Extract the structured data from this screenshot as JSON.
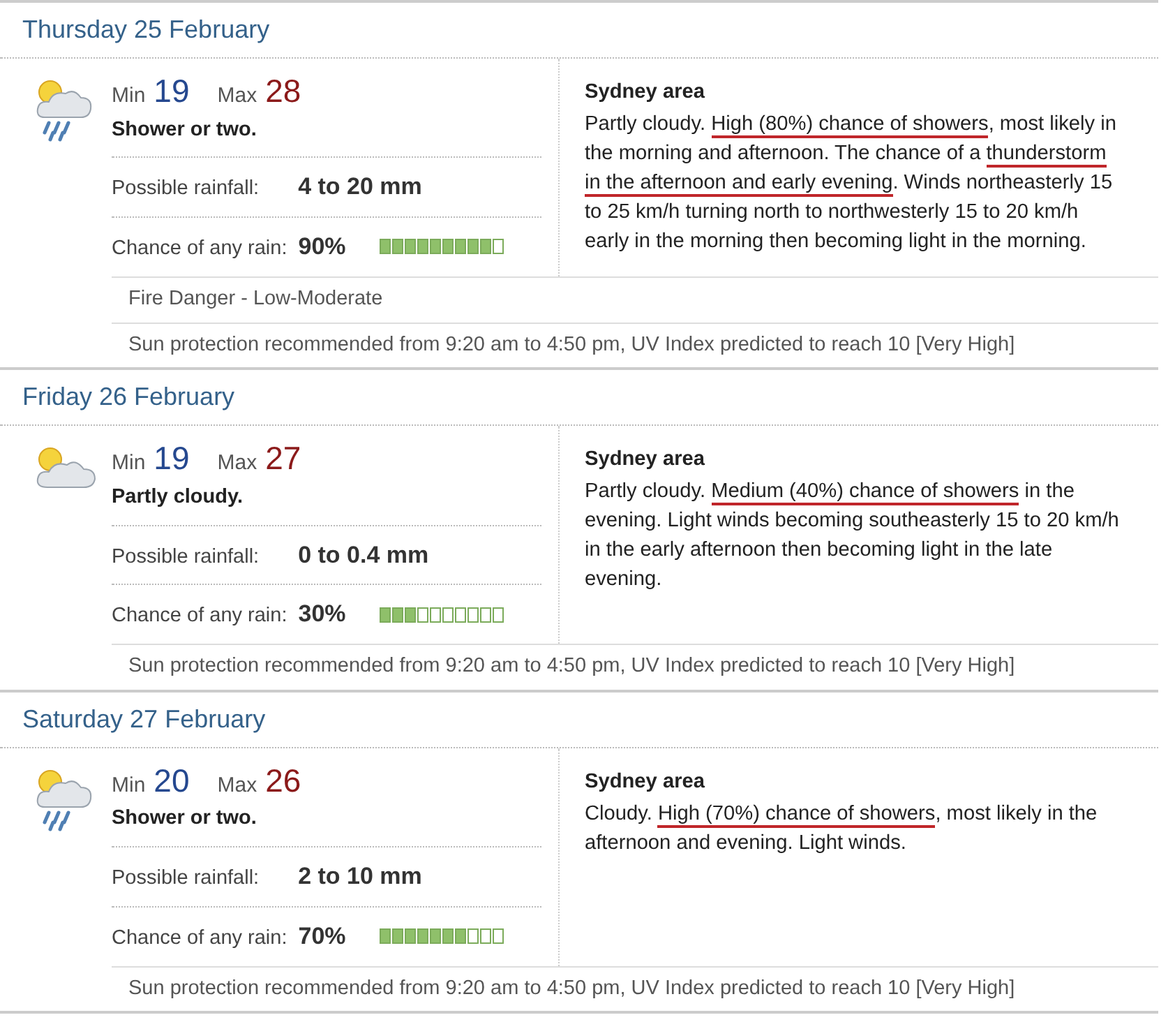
{
  "days": [
    {
      "title": "Thursday 25 February",
      "kind": "showers",
      "min_label": "Min",
      "min": "19",
      "max_label": "Max",
      "max": "28",
      "summary": "Shower or two.",
      "rainfall_label": "Possible rainfall:",
      "rainfall": "4 to 20 mm",
      "chance_label": "Chance of any rain:",
      "chance": "90%",
      "level": 0.9,
      "area": "Sydney area",
      "forecast": [
        {
          "text": "Partly cloudy. ",
          "underlined": false
        },
        {
          "text": "High (80%) chance of showers",
          "underlined": true
        },
        {
          "text": ", most likely in the morning and afternoon. The chance of a ",
          "underlined": false
        },
        {
          "text": "thunderstorm in the afternoon and early evening",
          "underlined": true
        },
        {
          "text": ". Winds northeasterly 15 to 25 km/h turning north to northwesterly 15 to 20 km/h early in the morning then becoming light in the morning.",
          "underlined": false
        }
      ],
      "notes": [
        "Fire Danger - Low-Moderate",
        "Sun protection recommended from 9:20 am to 4:50 pm, UV Index predicted to reach 10 [Very High]"
      ]
    },
    {
      "title": "Friday 26 February",
      "kind": "partly-cloudy",
      "min_label": "Min",
      "min": "19",
      "max_label": "Max",
      "max": "27",
      "summary": "Partly cloudy.",
      "rainfall_label": "Possible rainfall:",
      "rainfall": "0 to 0.4 mm",
      "chance_label": "Chance of any rain:",
      "chance": "30%",
      "level": 0.3,
      "area": "Sydney area",
      "forecast": [
        {
          "text": "Partly cloudy. ",
          "underlined": false
        },
        {
          "text": "Medium (40%) chance of showers",
          "underlined": true
        },
        {
          "text": " in the evening. Light winds becoming southeasterly 15 to 20 km/h in the early afternoon then becoming light in the late evening.",
          "underlined": false
        }
      ],
      "notes": [
        "Sun protection recommended from 9:20 am to 4:50 pm, UV Index predicted to reach 10 [Very High]"
      ]
    },
    {
      "title": "Saturday 27 February",
      "kind": "showers",
      "min_label": "Min",
      "min": "20",
      "max_label": "Max",
      "max": "26",
      "summary": "Shower or two.",
      "rainfall_label": "Possible rainfall:",
      "rainfall": "2 to 10 mm",
      "chance_label": "Chance of any rain:",
      "chance": "70%",
      "level": 0.7,
      "area": "Sydney area",
      "forecast": [
        {
          "text": "Cloudy. ",
          "underlined": false
        },
        {
          "text": "High (70%) chance of showers",
          "underlined": true
        },
        {
          "text": ", most likely in the afternoon and evening. Light winds.",
          "underlined": false
        }
      ],
      "notes": [
        "Sun protection recommended from 9:20 am to 4:50 pm, UV Index predicted to reach 10 [Very High]"
      ]
    }
  ]
}
